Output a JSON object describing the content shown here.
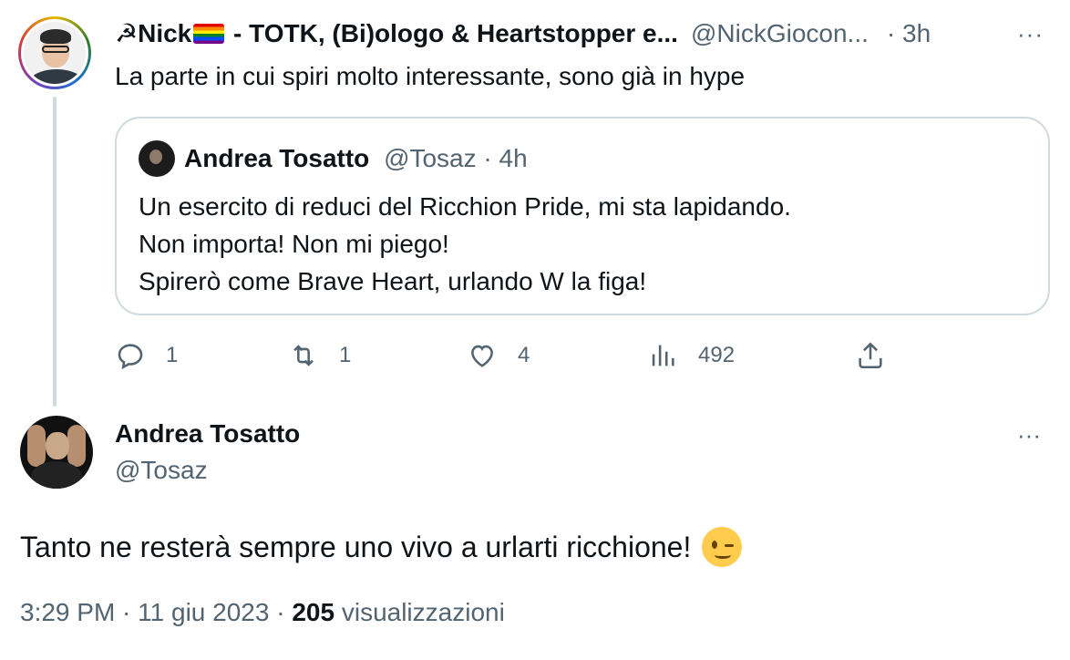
{
  "parent_tweet": {
    "display_name_prefix": "☭Nick",
    "display_name_suffix": " - TOTK, (Bi)ologo & Heartstopper e...",
    "handle": "@NickGiocon...",
    "time": "· 3h",
    "text": "La parte in cui spiri molto interessante, sono già in hype",
    "more_icon": "···"
  },
  "quoted_tweet": {
    "name": "Andrea Tosatto",
    "handle_time": "@Tosaz · 4h",
    "lines": [
      "Un esercito di reduci del Ricchion Pride, mi sta lapidando.",
      "Non importa! Non mi piego!",
      "Spirerò come Brave Heart, urlando W la figa!"
    ]
  },
  "actions": {
    "replies": "1",
    "retweets": "1",
    "likes": "4",
    "views": "492"
  },
  "main_tweet": {
    "name": "Andrea Tosatto",
    "handle": "@Tosaz",
    "text": "Tanto ne resterà sempre uno vivo a urlarti ricchione!",
    "more_icon": "···",
    "time": "3:29 PM",
    "date": "11 giu 2023",
    "sep": " · ",
    "views_count": "205",
    "views_label": " visualizzazioni"
  },
  "colors": {
    "text_primary": "#0f1419",
    "text_secondary": "#536471",
    "border": "#cfd9de"
  }
}
